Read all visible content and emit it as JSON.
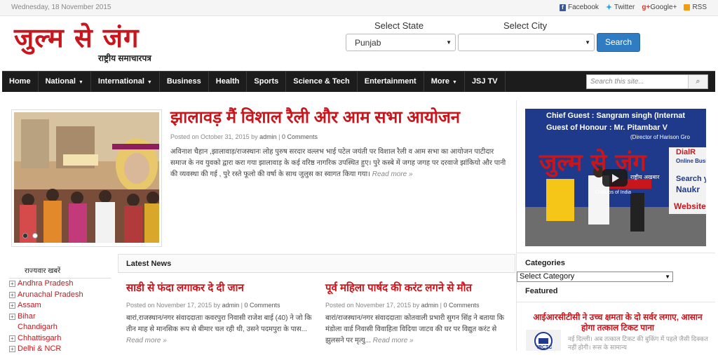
{
  "topbar": {
    "date": "Wednesday, 18 November 2015",
    "social": [
      {
        "label": "Facebook",
        "icon": "facebook-icon"
      },
      {
        "label": "Twitter",
        "icon": "twitter-icon"
      },
      {
        "label": "Google+",
        "icon": "google-plus-icon"
      },
      {
        "label": "RSS",
        "icon": "rss-icon"
      }
    ]
  },
  "logo": {
    "title": "जुल्म से जंग",
    "subtitle": "राष्ट्रीय समाचारपत्र"
  },
  "location": {
    "state_label": "Select State",
    "city_label": "Select City",
    "state_value": "Punjab",
    "city_value": "",
    "search_label": "Search"
  },
  "nav": {
    "items": [
      {
        "label": "Home",
        "dropdown": false
      },
      {
        "label": "National",
        "dropdown": true
      },
      {
        "label": "International",
        "dropdown": true
      },
      {
        "label": "Business",
        "dropdown": false
      },
      {
        "label": "Health",
        "dropdown": false
      },
      {
        "label": "Sports",
        "dropdown": false
      },
      {
        "label": "Science & Tech",
        "dropdown": false
      },
      {
        "label": "Entertainment",
        "dropdown": false
      },
      {
        "label": "More",
        "dropdown": true
      },
      {
        "label": "JSJ TV",
        "dropdown": false
      }
    ],
    "search_placeholder": "Search this site..."
  },
  "lead": {
    "title": "झालावड़ मैं विशाल रैली और आम सभा आयोजन",
    "posted_on": "Posted on October 31, 2015 by",
    "author": "admin",
    "comments": "0 Comments",
    "body": "अविनाश चैहान ,झालावाड़/राजस्थानः लोह पुरुष सरदार वल्लभ भाई पटेल जयंती पर विशाल रैली व आम सभा का आयोजन पाटीदार समाज के नव युवको द्वारा करा गया झालावाड़ के कई वरिष्ठ नागरिक उपस्थित हुए। पुरे कस्बे में जगह जगह पर दरवाजे झांकियो और पानी की व्यवस्था की गई , पुरे रस्ते फूलो की वर्षा के साथ जुलुस का स्वागत किया गया।",
    "read_more": "Read more »",
    "slides": 2,
    "active_slide": 1
  },
  "states": {
    "heading": "राज्यवार खबरें",
    "items": [
      {
        "label": "Andhra Pradesh",
        "expandable": true
      },
      {
        "label": "Arunachal Pradesh",
        "expandable": true
      },
      {
        "label": "Assam",
        "expandable": true
      },
      {
        "label": "Bihar",
        "expandable": true
      },
      {
        "label": "Chandigarh",
        "expandable": false
      },
      {
        "label": "Chhattisgarh",
        "expandable": true
      },
      {
        "label": "Delhi & NCR",
        "expandable": true
      }
    ]
  },
  "latest": {
    "heading": "Latest News",
    "posts": [
      {
        "title": "साडी से फंदा लगाकर दे दी जान",
        "posted_on": "Posted on November 17, 2015 by",
        "author": "admin",
        "comments": "0 Comments",
        "body": "बारां,राजस्थान/नगर संवाददाताः कवरपुरा निवासी राजेश बाई (40) ने जो कि तीन माह से मानसिक रूप से बीमार चल रही थी, उसने पदमपुरा के पास...",
        "read_more": "Read more »"
      },
      {
        "title": "पूर्व महिला पार्षद की करंट लगने से मौत",
        "posted_on": "Posted on November 17, 2015 by",
        "author": "admin",
        "comments": "0 Comments",
        "body": "बारां/राजस्थान/नगर संवाददाताः कोतवाली प्रभारी सुगन सिंह ने बताया कि मंडोला वार्ड निवासी विवाहिता विदिया जाटव की घर पर विद्युत करंट से झुलसने पर मृत्यु...",
        "read_more": "Read more »"
      }
    ]
  },
  "video": {
    "line1": "Chief Guest : Sangram singh (Internat",
    "line2": "Guest of Honour : Mr. Pitambar V",
    "line3": "(Director of Harison Gro",
    "banner": "जुल्म से जंग",
    "banner_sub": "राष्ट्रीय अखबार",
    "side1": "DialR",
    "side1b": "Online Busi",
    "side2": "Search y",
    "side3": "Naukr",
    "side4": "Website",
    "side5": "Champs of India"
  },
  "sidebar": {
    "categories_heading": "Categories",
    "category_value": "Select Category",
    "featured_heading": "Featured",
    "featured_title": "आईआरसीटीसी ने उच्च क्षमता के दो सर्वर लगाए, आसान होगा तत्काल टिकट पाना",
    "featured_body": "नई दिल्ली। अब तत्काल टिकट की बुकिंग में पहले जैसी दिक्कत नहीं होगी। रूस के सामान्य",
    "featured_logo": "IRCTC"
  },
  "colors": {
    "brand_red": "#c8161d",
    "nav_bg": "#1c1c1c",
    "search_blue": "#2f7cc2"
  }
}
